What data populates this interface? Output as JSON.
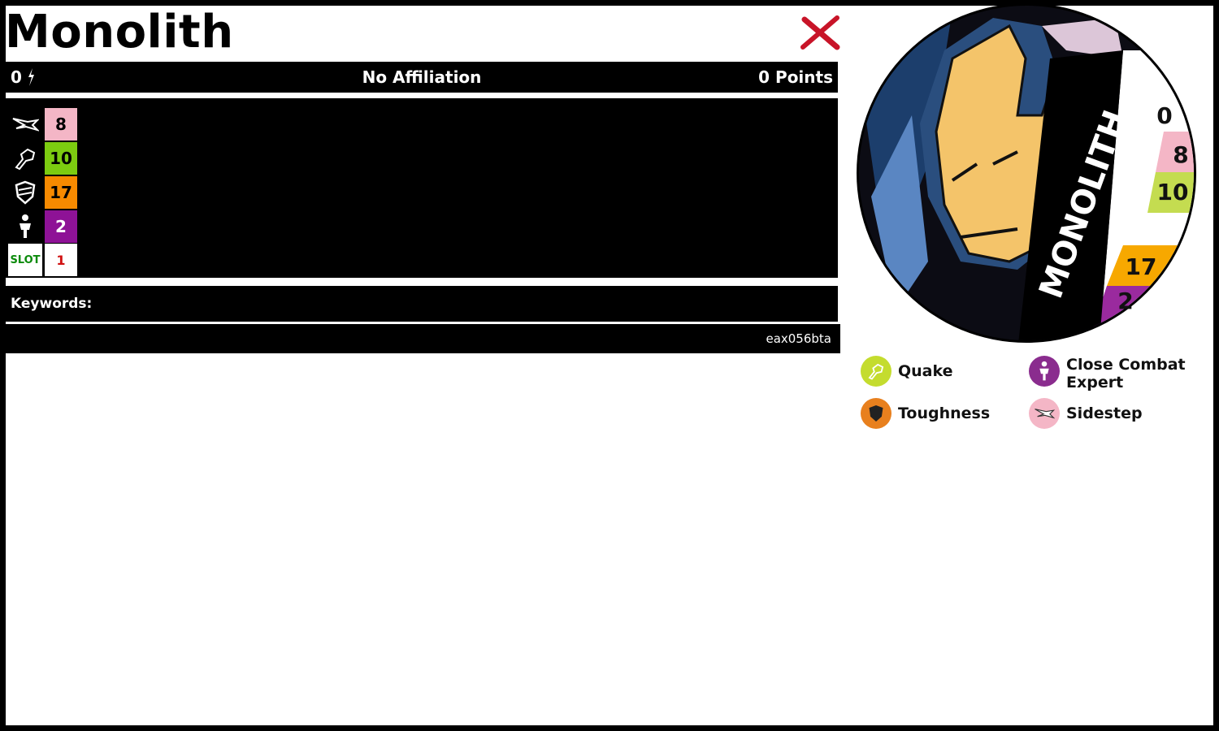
{
  "card": {
    "name": "Monolith",
    "point_cost": "0",
    "affiliation": "No Affiliation",
    "points": "0 Points",
    "keywords_label": "Keywords:",
    "code": "eax056bta"
  },
  "stats": [
    {
      "icon": "speed-icon",
      "value": "8",
      "color": "#f4b6c6"
    },
    {
      "icon": "attack-icon",
      "value": "10",
      "color": "#7ccc10"
    },
    {
      "icon": "defense-icon",
      "value": "17",
      "color": "#f78a00"
    },
    {
      "icon": "damage-icon",
      "value": "2",
      "color": "#8e1296"
    }
  ],
  "slot": {
    "label": "SLOT",
    "value": "1"
  },
  "dial": {
    "name": "MONOLITH",
    "point": "0",
    "speed": "8",
    "attack": "10",
    "range": "0",
    "defense": "17",
    "damage": "2"
  },
  "powers": [
    {
      "name": "Quake",
      "icon": "attack-icon",
      "color": "#c4dc2e"
    },
    {
      "name": "Close Combat Expert",
      "icon": "damage-icon",
      "color": "#8a2c8e"
    },
    {
      "name": "Toughness",
      "icon": "defense-icon",
      "color": "#e8801e"
    },
    {
      "name": "Sidestep",
      "icon": "speed-icon",
      "color": "#f4b6c6"
    }
  ]
}
